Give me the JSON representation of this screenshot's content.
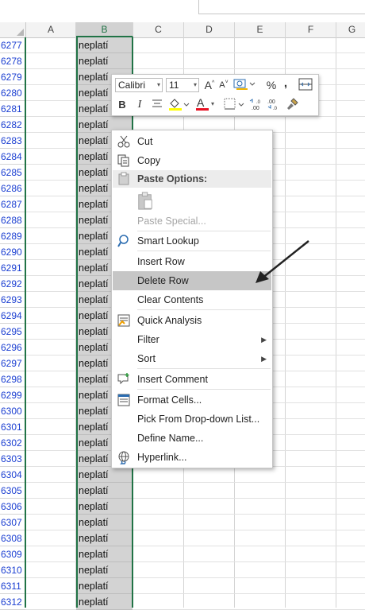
{
  "columns": [
    "A",
    "B",
    "C",
    "D",
    "E",
    "F",
    "G"
  ],
  "selected_column": "B",
  "rows": [
    "6277",
    "6278",
    "6279",
    "6280",
    "6281",
    "6282",
    "6283",
    "6284",
    "6285",
    "6286",
    "6287",
    "6288",
    "6289",
    "6290",
    "6291",
    "6292",
    "6293",
    "6294",
    "6295",
    "6296",
    "6297",
    "6298",
    "6299",
    "6300",
    "6301",
    "6302",
    "6303",
    "6304",
    "6305",
    "6306",
    "6307",
    "6308",
    "6309",
    "6310",
    "6311",
    "6312"
  ],
  "cell_value": "neplatí",
  "mini_toolbar": {
    "font_name": "Calibri",
    "font_size": "11",
    "grow_font": "A",
    "shrink_font": "A",
    "percent": "%",
    "comma": ",",
    "bold": "B",
    "italic": "I",
    "font_color_letter": "A",
    "inc_decimal": ".00",
    "dec_decimal": ".00",
    "font_color": "#e81123",
    "highlight_color": "#ffff00"
  },
  "context_menu": {
    "cut": "Cut",
    "copy": "Copy",
    "paste_options": "Paste Options:",
    "paste_special": "Paste Special...",
    "smart_lookup": "Smart Lookup",
    "insert_row": "Insert Row",
    "delete_row": "Delete Row",
    "clear_contents": "Clear Contents",
    "quick_analysis": "Quick Analysis",
    "filter": "Filter",
    "sort": "Sort",
    "insert_comment": "Insert Comment",
    "format_cells": "Format Cells...",
    "pick_from_dropdown": "Pick From Drop-down List...",
    "define_name": "Define Name...",
    "hyperlink": "Hyperlink..."
  },
  "colors": {
    "selection_green": "#217346",
    "row_number_blue": "#1a3ed1",
    "selected_fill": "#d3d3d3"
  }
}
